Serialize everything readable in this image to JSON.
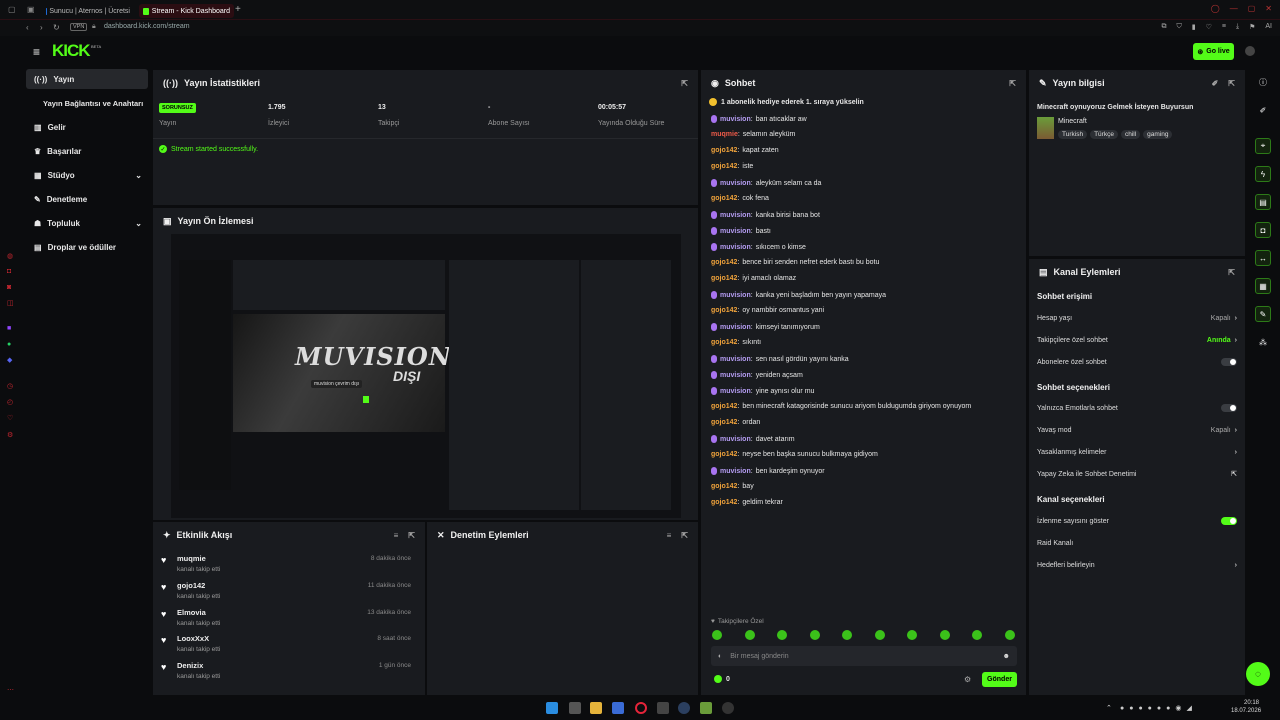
{
  "browser": {
    "tabs": [
      {
        "label": "Sunucu | Aternos | Ücretsi"
      },
      {
        "label": "Stream - Kick Dashboard"
      }
    ],
    "url": "dashboard.kick.com/stream",
    "vpn_label": "VPN",
    "ai_label": "AI"
  },
  "brand": {
    "logo": "KICK",
    "beta": "BETA",
    "go_live": "Go live",
    "accent": "#53fc18"
  },
  "nav": {
    "items": [
      {
        "label": "Yayın"
      },
      {
        "label": "Yayın Bağlantısı ve Anahtarı"
      },
      {
        "label": "Gelir"
      },
      {
        "label": "Başarılar"
      },
      {
        "label": "Stüdyo"
      },
      {
        "label": "Denetleme"
      },
      {
        "label": "Topluluk"
      },
      {
        "label": "Droplar ve ödüller"
      }
    ]
  },
  "stats": {
    "title": "Yayın İstatistikleri",
    "status_badge": "SORUNSUZ",
    "items": [
      {
        "value": "",
        "label": "Yayın"
      },
      {
        "value": "1.795",
        "label": "İzleyici"
      },
      {
        "value": "13",
        "label": "Takipçi"
      },
      {
        "value": "-",
        "label": "Abone Sayısı"
      },
      {
        "value": "00:05:57",
        "label": "Yayında Olduğu Süre"
      }
    ],
    "success": "Stream started successfully."
  },
  "preview": {
    "title": "Yayın Ön İzlemesi",
    "overlay_text": "MUVISION",
    "overlay_sub": "DIŞI",
    "offline_label": "muvision çevrim dışı"
  },
  "activity": {
    "title": "Etkinlik Akışı",
    "items": [
      {
        "name": "muqmie",
        "sub": "kanalı takip etti",
        "time": "8 dakika önce"
      },
      {
        "name": "gojo142",
        "sub": "kanalı takip etti",
        "time": "11 dakika önce"
      },
      {
        "name": "Elmovia",
        "sub": "kanalı takip etti",
        "time": "13 dakika önce"
      },
      {
        "name": "LooxXxX",
        "sub": "kanalı takip etti",
        "time": "8 saat önce"
      },
      {
        "name": "Denizix",
        "sub": "kanalı takip etti",
        "time": "1 gün önce"
      }
    ]
  },
  "moderation": {
    "title": "Denetim Eylemleri"
  },
  "chat": {
    "title": "Sohbet",
    "pinned": "1 abonelik hediye ederek 1. sıraya yükselin",
    "messages": [
      {
        "user": "muvision",
        "text": "ban atıcaklar aw",
        "color": "mu",
        "badge": true
      },
      {
        "user": "muqmie",
        "text": "selamın aleyküm",
        "color": "mq",
        "badge": false
      },
      {
        "user": "gojo142",
        "text": "kapat zaten",
        "color": "go",
        "badge": false
      },
      {
        "user": "gojo142",
        "text": "iste",
        "color": "go",
        "badge": false
      },
      {
        "user": "muvision",
        "text": "aleyküm selam ca da",
        "color": "mu",
        "badge": true
      },
      {
        "user": "gojo142",
        "text": "cok fena",
        "color": "go",
        "badge": false
      },
      {
        "user": "muvision",
        "text": "kanka birisi bana bot",
        "color": "mu",
        "badge": true
      },
      {
        "user": "muvision",
        "text": "bastı",
        "color": "mu",
        "badge": true
      },
      {
        "user": "muvision",
        "text": "sıkıcem o kimse",
        "color": "mu",
        "badge": true
      },
      {
        "user": "gojo142",
        "text": "bence biri senden nefret ederk bastı bu botu",
        "color": "go",
        "badge": false
      },
      {
        "user": "gojo142",
        "text": "iyi amaclı olamaz",
        "color": "go",
        "badge": false
      },
      {
        "user": "muvision",
        "text": "kanka yeni başladım ben yayın yapamaya",
        "color": "mu",
        "badge": true
      },
      {
        "user": "gojo142",
        "text": "oy nambbir osmantus yani",
        "color": "go",
        "badge": false
      },
      {
        "user": "muvision",
        "text": "kimseyi tanımıyorum",
        "color": "mu",
        "badge": true
      },
      {
        "user": "gojo142",
        "text": "sıkıntı",
        "color": "go",
        "badge": false
      },
      {
        "user": "muvision",
        "text": "sen nasıl gördün yayını kanka",
        "color": "mu",
        "badge": true
      },
      {
        "user": "muvision",
        "text": "yeniden açsam",
        "color": "mu",
        "badge": true
      },
      {
        "user": "muvision",
        "text": "yine aynısı olur mu",
        "color": "mu",
        "badge": true
      },
      {
        "user": "gojo142",
        "text": "ben minecraft katagorisinde sunucu ariyom buldugumda giriyom oynuyom",
        "color": "go",
        "badge": false
      },
      {
        "user": "gojo142",
        "text": "ordan",
        "color": "go",
        "badge": false
      },
      {
        "user": "muvision",
        "text": "davet atarım",
        "color": "mu",
        "badge": true
      },
      {
        "user": "gojo142",
        "text": "neyse ben başka sunucu bulkmaya gidiyom",
        "color": "go",
        "badge": false
      },
      {
        "user": "muvision",
        "text": "ben kardeşim oynuyor",
        "color": "mu",
        "badge": true
      },
      {
        "user": "gojo142",
        "text": "bay",
        "color": "go",
        "badge": false
      },
      {
        "user": "gojo142",
        "text": "geldim tekrar",
        "color": "go",
        "badge": false
      }
    ],
    "followers_only": "Takipçilere Özel",
    "input_placeholder": "Bir mesaj gönderin",
    "points": "0",
    "send": "Gönder"
  },
  "info": {
    "title": "Yayın bilgisi",
    "stream_title": "Minecraft oynuyoruz Gelmek İsteyen Buyursun",
    "category": "Minecraft",
    "tags": [
      "Turkish",
      "Türkçe",
      "chill",
      "gaming"
    ]
  },
  "channel": {
    "title": "Kanal Eylemleri",
    "chat_access": "Sohbet erişimi",
    "account_age": "Hesap yaşı",
    "account_age_val": "Kapalı",
    "followers_chat": "Takipçilere özel sohbet",
    "followers_chat_val": "Anında",
    "subs_chat": "Abonelere özel sohbet",
    "chat_options": "Sohbet seçenekleri",
    "emotes_only": "Yalnızca Emotlarla sohbet",
    "slow_mode": "Yavaş mod",
    "slow_mode_val": "Kapalı",
    "banned_words": "Yasaklanmış kelimeler",
    "ai_moderation": "Yapay Zeka ile Sohbet Denetimi",
    "channel_options": "Kanal seçenekleri",
    "show_viewers": "İzlenme sayısını göster",
    "raid": "Raid Kanalı",
    "goals": "Hedefleri belirleyin"
  },
  "taskbar": {
    "time": "20:18",
    "date": "18.07.2026"
  }
}
